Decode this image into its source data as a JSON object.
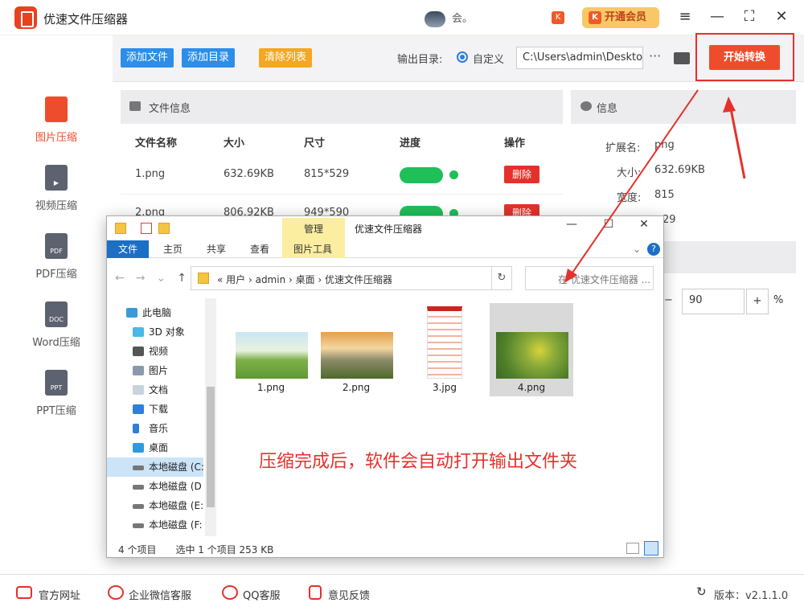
{
  "app": {
    "title": "优速文件压缩器",
    "user_text": "会。",
    "vip_label": "开通会员",
    "version": "版本：v2.1.1.0"
  },
  "sidebar": {
    "items": [
      {
        "label": "图片压缩",
        "icon": "image-file-icon",
        "icon_text": "",
        "active": true
      },
      {
        "label": "视频压缩",
        "icon": "video-file-icon",
        "icon_text": "▶",
        "active": false
      },
      {
        "label": "PDF压缩",
        "icon": "pdf-file-icon",
        "icon_text": "PDF",
        "active": false
      },
      {
        "label": "Word压缩",
        "icon": "doc-file-icon",
        "icon_text": "DOC",
        "active": false
      },
      {
        "label": "PPT压缩",
        "icon": "ppt-file-icon",
        "icon_text": "PPT",
        "active": false
      }
    ]
  },
  "toolbar": {
    "add_file": "添加文件",
    "add_dir": "添加目录",
    "clear_list": "清除列表",
    "output_label": "输出目录:",
    "radio_label": "自定义",
    "output_path": "C:\\Users\\admin\\Deskto",
    "more": "···",
    "start": "开始转换"
  },
  "file_table": {
    "heading": "文件信息",
    "columns": [
      "文件名称",
      "大小",
      "尺寸",
      "进度",
      "操作"
    ],
    "rows": [
      {
        "name": "1.png",
        "size": "632.69KB",
        "dims": "815*529",
        "delete": "删除"
      },
      {
        "name": "2.png",
        "size": "806.92KB",
        "dims": "949*590",
        "delete": "删除"
      }
    ]
  },
  "info": {
    "heading": "信息",
    "ext_label": "扩展名:",
    "ext": "png",
    "size_label": "大小:",
    "size": "632.69KB",
    "width_label": "宽度:",
    "width": "815",
    "height_value": "29",
    "quality": "90",
    "quality_plus": "+",
    "quality_minus": "−",
    "pct": "%"
  },
  "explorer": {
    "title": "优速文件压缩器",
    "manage_tab": "管理",
    "tabs": [
      "文件",
      "主页",
      "共享",
      "查看",
      "图片工具"
    ],
    "breadcrumb": "«  用户  ›  admin  ›  桌面  ›  优速文件压缩器",
    "search_placeholder": "在 优速文件压缩器 ...",
    "nav": [
      "此电脑",
      "3D 对象",
      "视频",
      "图片",
      "文档",
      "下载",
      "音乐",
      "桌面",
      "本地磁盘 (C:",
      "本地磁盘 (D",
      "本地磁盘 (E:",
      "本地磁盘 (F:"
    ],
    "files": [
      "1.png",
      "2.png",
      "3.jpg",
      "4.png"
    ],
    "status_count": "4 个项目",
    "status_selected": "选中 1 个项目  253 KB"
  },
  "annotation": "压缩完成后，软件会自动打开输出文件夹",
  "footer": {
    "website": "官方网址",
    "wechat": "企业微信客服",
    "qq": "QQ客服",
    "feedback": "意见反馈"
  },
  "colors": {
    "accent": "#ee4d2d",
    "blue_button": "#2c8ee8",
    "orange_button": "#f5a623",
    "progress": "#1fbf5a",
    "annotation": "#e5312b"
  }
}
